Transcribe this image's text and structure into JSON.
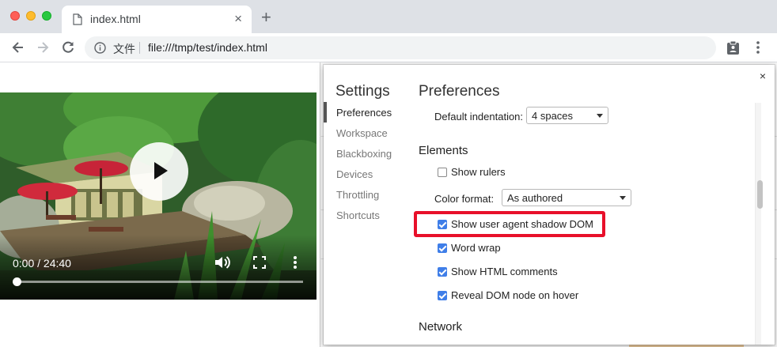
{
  "browser": {
    "tab_title": "index.html",
    "site_chip": "文件",
    "url": "file:///tmp/test/index.html"
  },
  "video": {
    "time": "0:00 / 24:40",
    "progress": 0
  },
  "settings": {
    "title": "Settings",
    "sidebar": [
      {
        "label": "Preferences",
        "active": true
      },
      {
        "label": "Workspace",
        "active": false
      },
      {
        "label": "Blackboxing",
        "active": false
      },
      {
        "label": "Devices",
        "active": false
      },
      {
        "label": "Throttling",
        "active": false
      },
      {
        "label": "Shortcuts",
        "active": false
      }
    ],
    "preferences_title": "Preferences",
    "default_indentation": {
      "label": "Default indentation:",
      "value": "4 spaces"
    },
    "elements_title": "Elements",
    "show_rulers": {
      "label": "Show rulers",
      "checked": false
    },
    "color_format": {
      "label": "Color format:",
      "value": "As authored"
    },
    "shadow_dom": {
      "label": "Show user agent shadow DOM",
      "checked": true
    },
    "word_wrap": {
      "label": "Word wrap",
      "checked": true
    },
    "html_comments": {
      "label": "Show HTML comments",
      "checked": true
    },
    "reveal_dom": {
      "label": "Reveal DOM node on hover",
      "checked": true
    },
    "network_title": "Network"
  },
  "colors": {
    "highlight": "#e8102a",
    "checkbox_accent": "#3f7ee8"
  }
}
